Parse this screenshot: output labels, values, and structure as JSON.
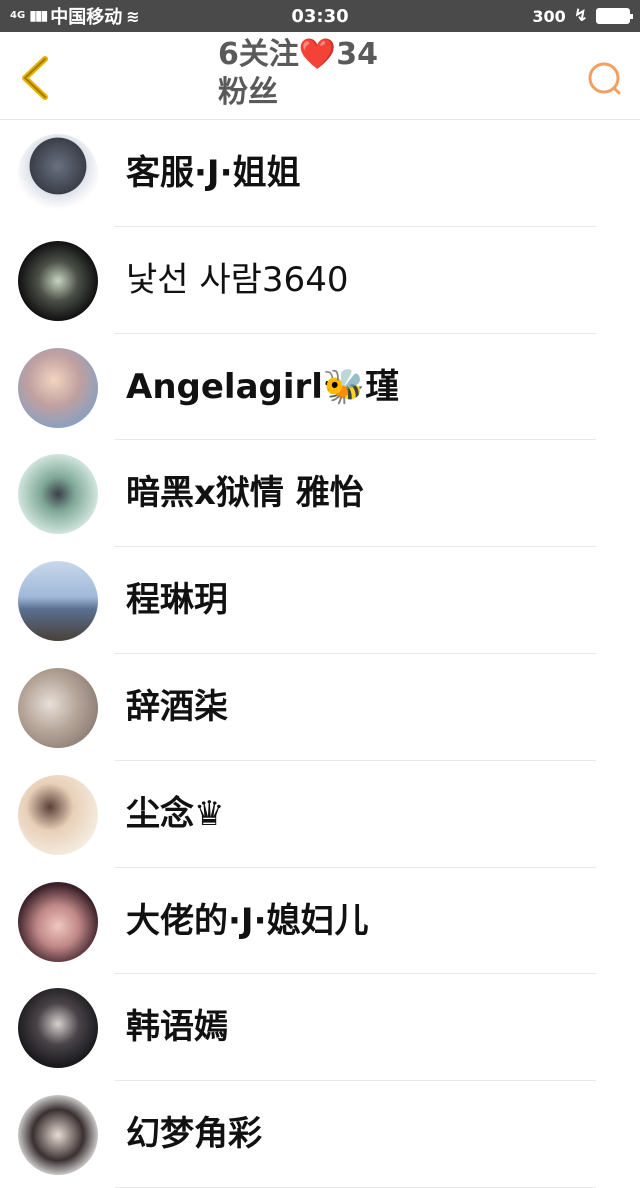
{
  "status_bar": {
    "network": "4G",
    "carrier": "中国移动",
    "time": "03:30",
    "speed": "300"
  },
  "header": {
    "title_line1": "6关注❤️34",
    "title_line2": "粉丝"
  },
  "colors": {
    "accent": "#e8b200",
    "search": "#f0a060",
    "status_bg": "#4a4a4a"
  },
  "fans": [
    {
      "name": "客服·J·姐姐"
    },
    {
      "name": "낯선 사람3640"
    },
    {
      "name": "Angelagirl🐝瑾"
    },
    {
      "name": "暗黑x狱情 雅怡"
    },
    {
      "name": "程琳玥"
    },
    {
      "name": "辞酒柒"
    },
    {
      "name": "尘念♛"
    },
    {
      "name": "大佬的·J·媳妇儿"
    },
    {
      "name": "韩语嫣"
    },
    {
      "name": "幻梦角彩"
    }
  ]
}
